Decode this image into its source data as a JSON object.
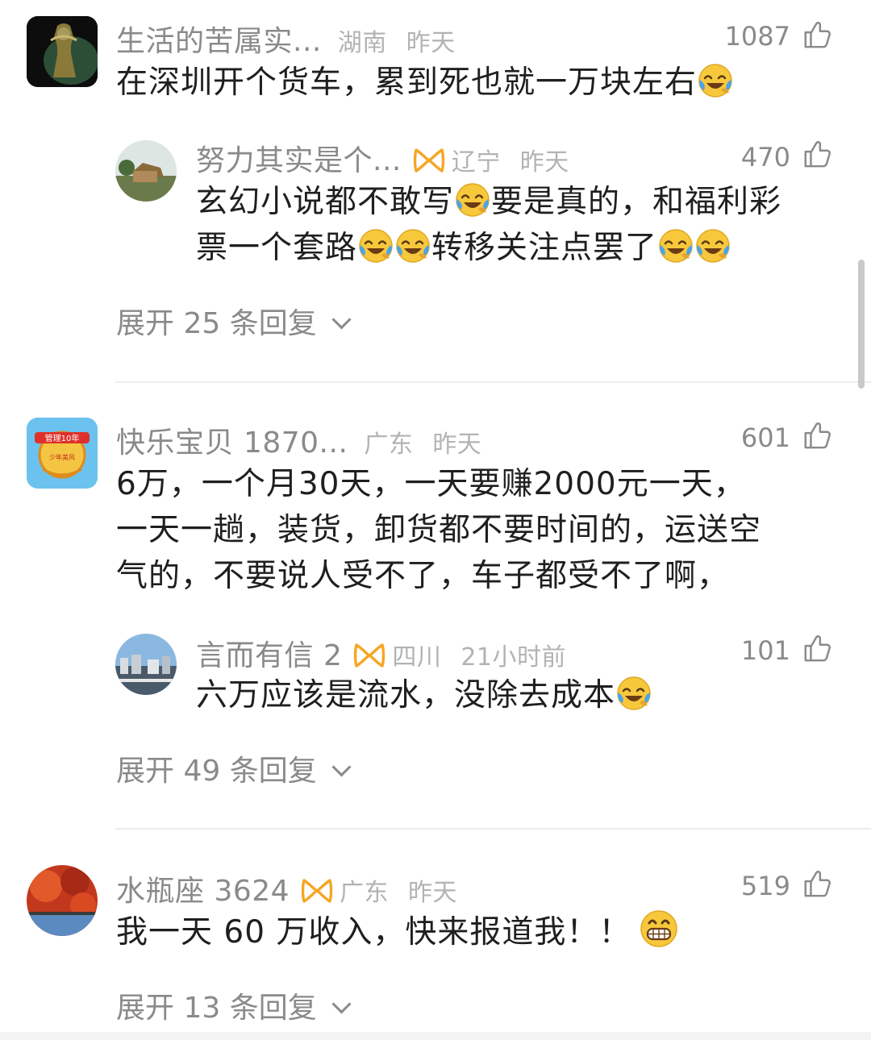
{
  "comments": [
    {
      "user": "生活的苦属实...",
      "region": "湖南",
      "time": "昨天",
      "likes": "1087",
      "text": "在深圳开个货车，累到死也就一万块左右",
      "reply": {
        "user": "努力其实是个...",
        "region": "辽宁",
        "time": "昨天",
        "likes": "470",
        "text1": "玄幻小说都不敢写",
        "text2": "要是真的，和福利彩",
        "text3": "票一个套路",
        "text4": "转移关注点罢了"
      },
      "expand": "展开 25 条回复"
    },
    {
      "user": "快乐宝贝 1870...",
      "region": "广东",
      "time": "昨天",
      "likes": "601",
      "text_lines": [
        "6万，一个月30天，一天要赚2000元一天，",
        "一天一趟，装货，卸货都不要时间的，运送空",
        "气的，不要说人受不了，车子都受不了啊，"
      ],
      "reply": {
        "user": "言而有信 2",
        "region": "四川",
        "time": "21小时前",
        "likes": "101",
        "text": "六万应该是流水，没除去成本"
      },
      "expand": "展开 49 条回复"
    },
    {
      "user": "水瓶座 3624",
      "region": "广东",
      "time": "昨天",
      "likes": "519",
      "text": "我一天 60 万收入，快来报道我！！",
      "expand": "展开 13 条回复"
    }
  ],
  "avatar_badge_lines": [
    "管理10年",
    "少年美风"
  ],
  "colors": {
    "text_primary": "#1f1f1f",
    "text_secondary": "#8a8a8a",
    "text_meta": "#b3b3b3",
    "vip_orange": "#f5a623",
    "divider": "#ededed"
  },
  "icons": [
    "thumb-up-icon",
    "vip-badge-icon",
    "laugh-cry-emoji",
    "grin-emoji",
    "chevron-down-icon"
  ]
}
